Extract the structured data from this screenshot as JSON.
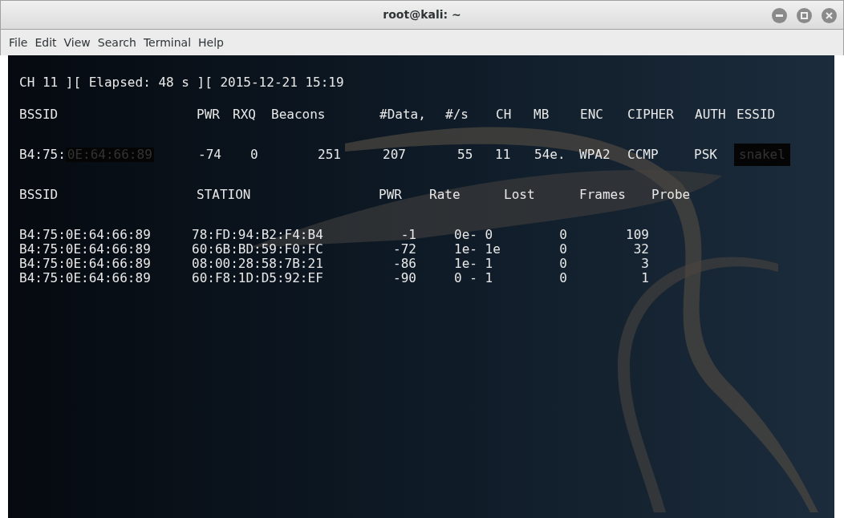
{
  "window": {
    "title": "root@kali: ~"
  },
  "menu": [
    "File",
    "Edit",
    "View",
    "Search",
    "Terminal",
    "Help"
  ],
  "status_line": "CH 11 ][ Elapsed: 48 s ][ 2015-12-21 15:19",
  "ap_table": {
    "columns": [
      "BSSID",
      "PWR",
      "RXQ",
      "Beacons",
      "#Data,",
      "#/s",
      "CH",
      "MB",
      "ENC",
      "CIPHER",
      "AUTH",
      "ESSID"
    ],
    "rows": [
      {
        "cells": [
          "B4:75:",
          "-74",
          "0",
          "251",
          "207",
          "55",
          "11",
          "54e.",
          "WPA2",
          "CCMP",
          "PSK",
          "snakel"
        ],
        "bssid_masked": "0E:64:66:89",
        "redacted": true
      }
    ]
  },
  "station_table": {
    "columns": [
      "BSSID",
      "STATION",
      "PWR",
      "Rate",
      "Lost",
      "Frames",
      "Probe"
    ],
    "rows": [
      {
        "cells": [
          "B4:75:0E:64:66:89",
          "78:FD:94:B2:F4:B4",
          "-1",
          "0e- 0",
          "0",
          "109"
        ]
      },
      {
        "cells": [
          "B4:75:0E:64:66:89",
          "60:6B:BD:59:F0:FC",
          "-72",
          "1e- 1e",
          "0",
          "32"
        ]
      },
      {
        "cells": [
          "B4:75:0E:64:66:89",
          "08:00:28:58:7B:21",
          "-86",
          "1e- 1",
          "0",
          "3"
        ]
      },
      {
        "cells": [
          "B4:75:0E:64:66:89",
          "60:F8:1D:D5:92:EF",
          "-90",
          "0 - 1",
          "0",
          "1"
        ]
      }
    ]
  }
}
